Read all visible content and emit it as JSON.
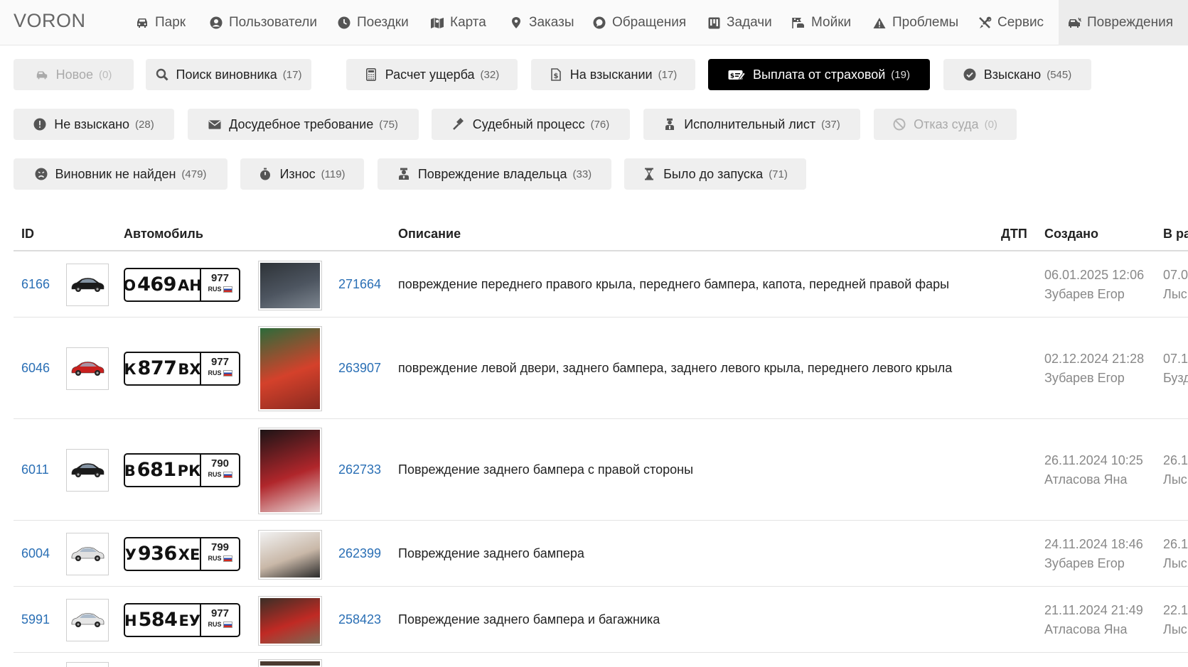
{
  "app": {
    "logo": "VORON"
  },
  "nav": {
    "items": [
      {
        "label": "Парк",
        "icon": "car-icon"
      },
      {
        "label": "Пользователи",
        "icon": "user-circle-icon"
      },
      {
        "label": "Поездки",
        "icon": "clock-icon"
      },
      {
        "label": "Карта",
        "icon": "map-icon"
      },
      {
        "label": "Заказы",
        "icon": "location-pin-icon"
      },
      {
        "label": "Обращения",
        "icon": "chat-icon"
      },
      {
        "label": "Задачи",
        "icon": "kanban-icon"
      },
      {
        "label": "Мойки",
        "icon": "car-wash-icon"
      },
      {
        "label": "Проблемы",
        "icon": "warning-icon"
      },
      {
        "label": "Сервис",
        "icon": "tools-icon"
      },
      {
        "label": "Повреждения",
        "icon": "car-crash-icon"
      }
    ],
    "active": "Повреждения"
  },
  "statuses": [
    {
      "label": "Новое",
      "count": "(0)",
      "icon": "car-crash-icon",
      "state": "disabled"
    },
    {
      "label": "Поиск виновника",
      "count": "(17)",
      "icon": "search-icon",
      "state": "normal"
    },
    {
      "label": "Расчет ущерба",
      "count": "(32)",
      "icon": "calculator-icon",
      "state": "normal"
    },
    {
      "label": "На взыскании",
      "count": "(17)",
      "icon": "invoice-icon",
      "state": "normal"
    },
    {
      "label": "Выплата от страховой",
      "count": "(19)",
      "icon": "money-check-icon",
      "state": "active"
    },
    {
      "label": "Взыскано",
      "count": "(545)",
      "icon": "check-circle-icon",
      "state": "normal"
    },
    {
      "label": "Не взыскано",
      "count": "(28)",
      "icon": "exclamation-circle-icon",
      "state": "normal"
    },
    {
      "label": "Досудебное требование",
      "count": "(75)",
      "icon": "envelope-icon",
      "state": "normal"
    },
    {
      "label": "Судебный процесс",
      "count": "(76)",
      "icon": "gavel-icon",
      "state": "normal"
    },
    {
      "label": "Исполнительный лист",
      "count": "(37)",
      "icon": "bailiff-icon",
      "state": "normal"
    },
    {
      "label": "Отказ суда",
      "count": "(0)",
      "icon": "ban-icon",
      "state": "disabled"
    },
    {
      "label": "Виновник не найден",
      "count": "(479)",
      "icon": "sad-face-icon",
      "state": "normal"
    },
    {
      "label": "Износ",
      "count": "(119)",
      "icon": "stopwatch-icon",
      "state": "normal"
    },
    {
      "label": "Повреждение владельца",
      "count": "(33)",
      "icon": "user-owner-icon",
      "state": "normal"
    },
    {
      "label": "Было до запуска",
      "count": "(71)",
      "icon": "hourglass-icon",
      "state": "normal"
    }
  ],
  "table": {
    "headers": {
      "id": "ID",
      "car": "Автомобиль",
      "description": "Описание",
      "accident": "ДТП",
      "created": "Создано",
      "in_work": "В ра"
    },
    "rows": [
      {
        "id": "6166",
        "car_color": "#1a1a1a",
        "plate": {
          "letter1": "О",
          "number": "469",
          "letters2": "АН",
          "region": "977",
          "country": "RUS"
        },
        "photo_palette": [
          "#2e3338",
          "#4d5560",
          "#7c858f"
        ],
        "ride_id": "271664",
        "description": "повреждение переднего правого крыла, переднего бампера, капота, передней правой фары",
        "created_date": "06.01.2025 12:06",
        "created_by": "Зубарев Егор",
        "work_date": "07.0",
        "work_by": "Лыс"
      },
      {
        "id": "6046",
        "car_color": "#c8201e",
        "plate": {
          "letter1": "К",
          "number": "877",
          "letters2": "ВХ",
          "region": "977",
          "country": "RUS"
        },
        "photo_palette": [
          "#2c6b3a",
          "#d4412b",
          "#8a2a20"
        ],
        "ride_id": "263907",
        "description": "повреждение левой двери, заднего бампера, заднего левого крыла, переднего левого крыла",
        "created_date": "02.12.2024 21:28",
        "created_by": "Зубарев Егор",
        "work_date": "07.1",
        "work_by": "Бузд"
      },
      {
        "id": "6011",
        "car_color": "#1a1a1a",
        "plate": {
          "letter1": "В",
          "number": "681",
          "letters2": "РК",
          "region": "790",
          "country": "RUS"
        },
        "photo_palette": [
          "#1d1416",
          "#b0262b",
          "#e8d8d8"
        ],
        "ride_id": "262733",
        "description": "Повреждение заднего бампера с правой стороны",
        "created_date": "26.11.2024 10:25",
        "created_by": "Атласова Яна",
        "work_date": "26.1",
        "work_by": "Лыс"
      },
      {
        "id": "6004",
        "car_color": "#e0e0e0",
        "plate": {
          "letter1": "У",
          "number": "936",
          "letters2": "ХЕ",
          "region": "799",
          "country": "RUS"
        },
        "photo_palette": [
          "#f1f1f1",
          "#c9b8a8",
          "#2a2a2a"
        ],
        "ride_id": "262399",
        "description": "Повреждение заднего бампера",
        "created_date": "24.11.2024 18:46",
        "created_by": "Зубарев Егор",
        "work_date": "26.1",
        "work_by": "Лыс"
      },
      {
        "id": "5991",
        "car_color": "#e6e6e6",
        "plate": {
          "letter1": "Н",
          "number": "584",
          "letters2": "ЕУ",
          "region": "977",
          "country": "RUS"
        },
        "photo_palette": [
          "#3a2f26",
          "#c02a24",
          "#7a6a55"
        ],
        "ride_id": "258423",
        "description": "Повреждение заднего бампера и багажника",
        "created_date": "21.11.2024 21:49",
        "created_by": "Атласова Яна",
        "work_date": "22.1",
        "work_by": "Лыс"
      }
    ]
  }
}
